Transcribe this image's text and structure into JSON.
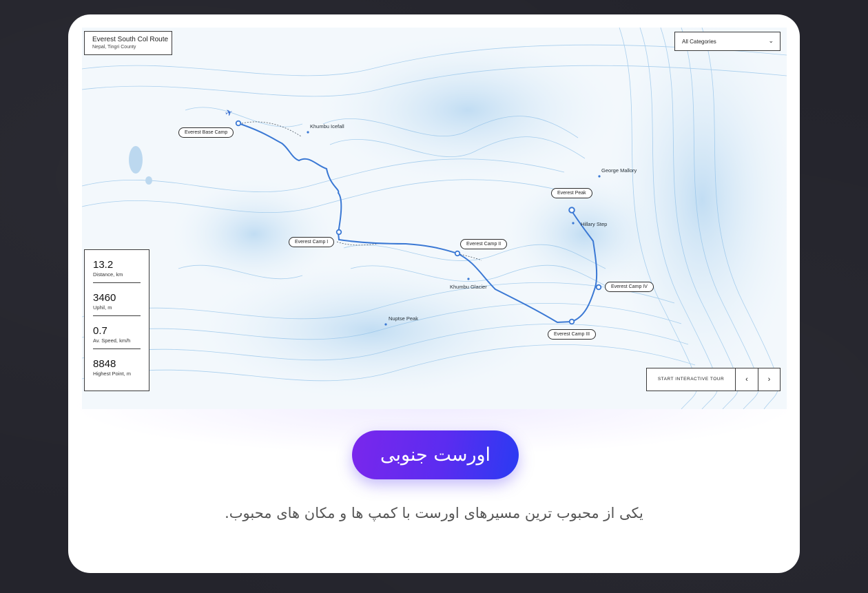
{
  "route": {
    "title": "Everest South Col Route",
    "subtitle": "Nepal, Tingri County"
  },
  "category": {
    "selected": "All Categories"
  },
  "stats": [
    {
      "value": "13.2",
      "label": "Distance, km"
    },
    {
      "value": "3460",
      "label": "Uphil, m"
    },
    {
      "value": "0.7",
      "label": "Av. Speed, km/h"
    },
    {
      "value": "8848",
      "label": "Highest Point, m"
    }
  ],
  "tour": {
    "start_label": "START INTERACTIVE TOUR",
    "prev": "‹",
    "next": "›"
  },
  "camps": {
    "base": "Everest Base Camp",
    "camp1": "Everest Camp I",
    "camp2": "Everest Camp II",
    "camp3": "Everest Camp III",
    "camp4": "Everest Camp IV",
    "peak": "Everest Peak"
  },
  "places": {
    "icefall": "Khumbu Icefall",
    "mallory": "George Mallory",
    "hillary": "Hillary Step",
    "glacier": "Khumbu Glacier",
    "nuptse": "Nuptse Peak"
  },
  "icons": {
    "airport": "airplane-icon",
    "dropdown": "chevron-down-icon"
  },
  "colors": {
    "route": "#3a78d4",
    "contour": "#7cb4e4",
    "accent_start": "#7a27ec",
    "accent_end": "#2a3bf2"
  },
  "heading": "اورست جنوبی",
  "description": "یکی از محبوب ترین مسیرهای اورست با کمپ ها و مکان های محبوب."
}
